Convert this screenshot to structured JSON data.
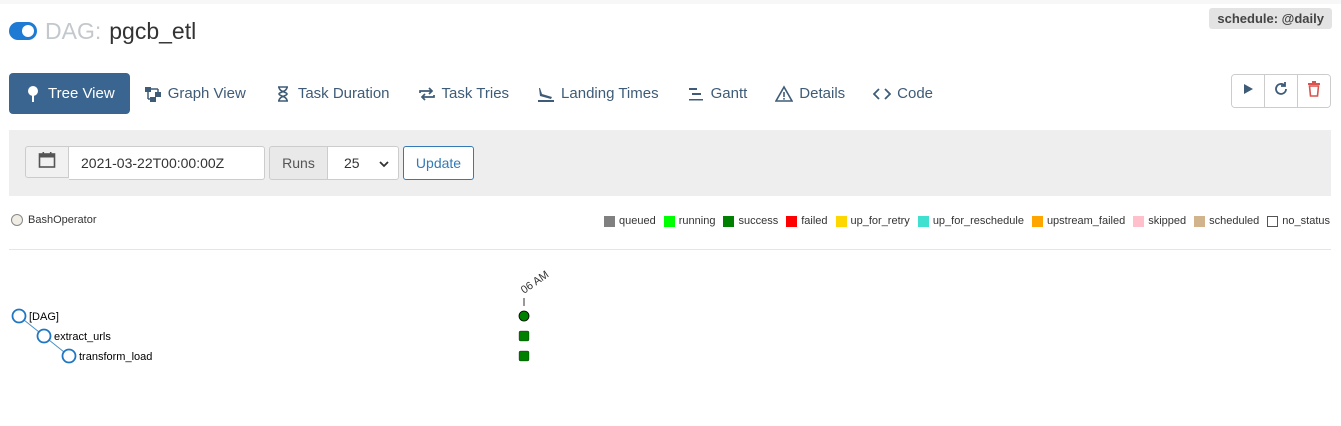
{
  "dag": {
    "prefix": "DAG:",
    "name": "pgcb_etl",
    "schedule": "schedule: @daily"
  },
  "nav": {
    "items": [
      {
        "label": "Tree View",
        "icon": "tree-icon",
        "active": true
      },
      {
        "label": "Graph View",
        "icon": "graph-icon"
      },
      {
        "label": "Task Duration",
        "icon": "hourglass-icon"
      },
      {
        "label": "Task Tries",
        "icon": "retry-arrows-icon"
      },
      {
        "label": "Landing Times",
        "icon": "plane-landing-icon"
      },
      {
        "label": "Gantt",
        "icon": "gantt-icon"
      },
      {
        "label": "Details",
        "icon": "warning-triangle-icon"
      },
      {
        "label": "Code",
        "icon": "code-icon"
      }
    ]
  },
  "actions": {
    "trigger": "play-icon",
    "refresh": "refresh-icon",
    "delete": "trash-icon",
    "delete_color": "#d9534f"
  },
  "controls": {
    "date_value": "2021-03-22T00:00:00Z",
    "runs_label": "Runs",
    "runs_value": "25",
    "update_label": "Update"
  },
  "operator_legend": {
    "label": "BashOperator",
    "color": "#f0ede4"
  },
  "state_legend": [
    {
      "label": "queued",
      "color": "#808080"
    },
    {
      "label": "running",
      "color": "#00ff00"
    },
    {
      "label": "success",
      "color": "#008000"
    },
    {
      "label": "failed",
      "color": "#ff0000"
    },
    {
      "label": "up_for_retry",
      "color": "#ffd700"
    },
    {
      "label": "up_for_reschedule",
      "color": "#40e0d0"
    },
    {
      "label": "upstream_failed",
      "color": "#ffa500"
    },
    {
      "label": "skipped",
      "color": "#ffc0cb"
    },
    {
      "label": "scheduled",
      "color": "#d2b48c"
    },
    {
      "label": "no_status",
      "color": "#ffffff"
    }
  ],
  "tree": {
    "run_label": "06 AM",
    "nodes": [
      {
        "label": "[DAG]",
        "level": 0,
        "state": "success"
      },
      {
        "label": "extract_urls",
        "level": 1,
        "state": "success"
      },
      {
        "label": "transform_load",
        "level": 2,
        "state": "success"
      }
    ]
  }
}
